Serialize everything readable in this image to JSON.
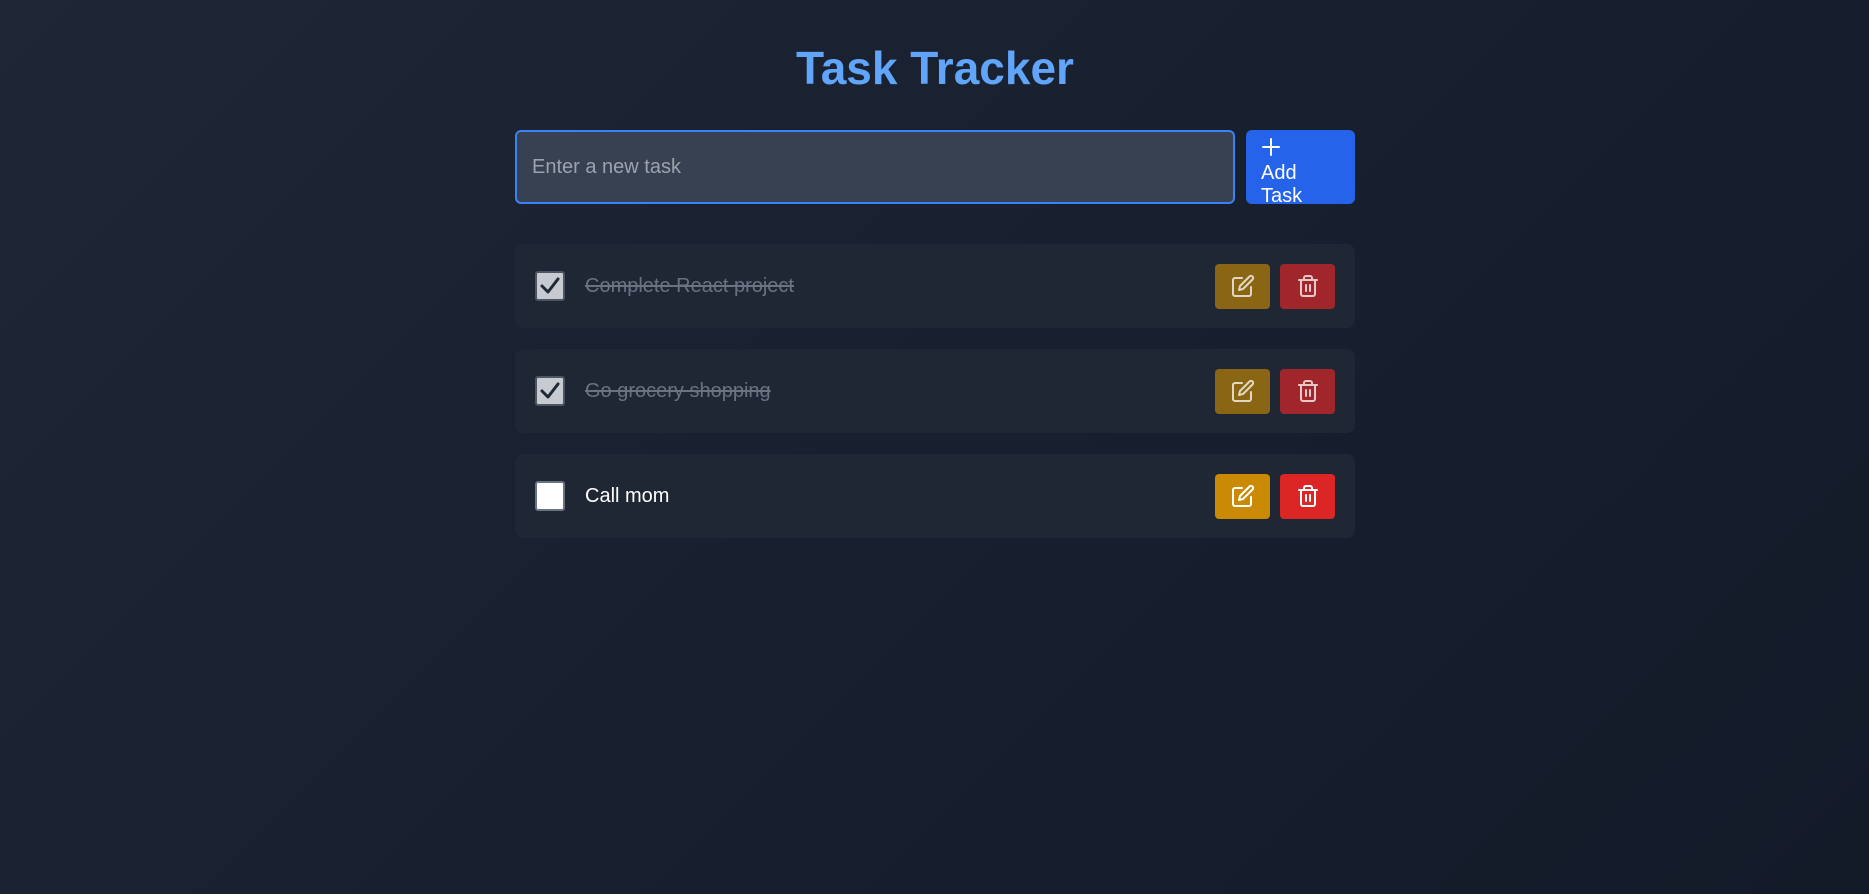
{
  "header": {
    "title": "Task Tracker"
  },
  "add_task": {
    "input_value": "",
    "placeholder": "Enter a new task",
    "button_icon": "plus-icon",
    "button_label": "Add Task"
  },
  "tasks": [
    {
      "text": "Complete React project",
      "completed": true
    },
    {
      "text": "Go grocery shopping",
      "completed": true
    },
    {
      "text": "Call mom",
      "completed": false
    }
  ],
  "icons": {
    "checked": "check-icon",
    "edit": "edit-icon",
    "delete": "trash-icon"
  },
  "colors": {
    "background": "#1a2130",
    "accent_title": "#60a5fa",
    "primary_button": "#2563eb",
    "input_border": "#3b82f6",
    "edit_button": "#ca8a04",
    "delete_button": "#dc2626",
    "task_card": "#1f2735"
  }
}
